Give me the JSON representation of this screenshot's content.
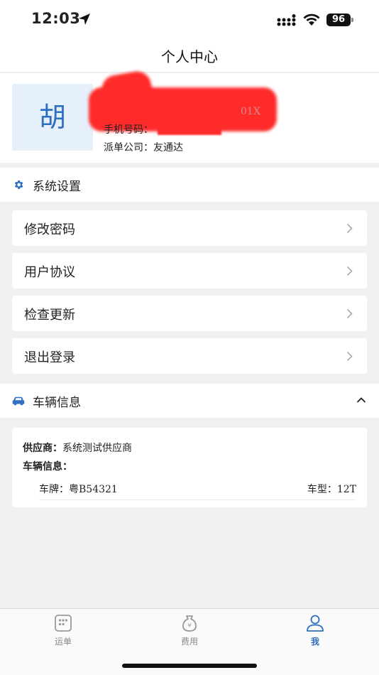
{
  "status_bar": {
    "time": "12:03",
    "battery": "96"
  },
  "nav": {
    "title": "个人中心"
  },
  "profile": {
    "avatar_char": "胡",
    "name_tail": "01X",
    "phone_label": "手机号码：",
    "company_label": "派单公司：",
    "company_value": "友通达"
  },
  "settings_section": {
    "label": "系统设置",
    "icon": "gear-icon",
    "accent": "#2f6fc1"
  },
  "menu": {
    "items": [
      {
        "label": "修改密码"
      },
      {
        "label": "用户协议"
      },
      {
        "label": "检查更新"
      },
      {
        "label": "退出登录"
      }
    ]
  },
  "vehicle_section": {
    "label": "车辆信息",
    "icon": "car-icon",
    "expanded": true
  },
  "vehicle": {
    "supplier_label": "供应商：",
    "supplier_value": "系统测试供应商",
    "info_label": "车辆信息：",
    "plate_label": "车牌：",
    "plate_value": "粤B54321",
    "type_label": "车型：",
    "type_value": "12T"
  },
  "tabbar": {
    "tabs": [
      {
        "label": "运单",
        "icon": "waybill-icon",
        "active": false
      },
      {
        "label": "费用",
        "icon": "money-bag-icon",
        "active": false
      },
      {
        "label": "我",
        "icon": "user-icon",
        "active": true
      }
    ],
    "active_color": "#2f6fc1"
  }
}
